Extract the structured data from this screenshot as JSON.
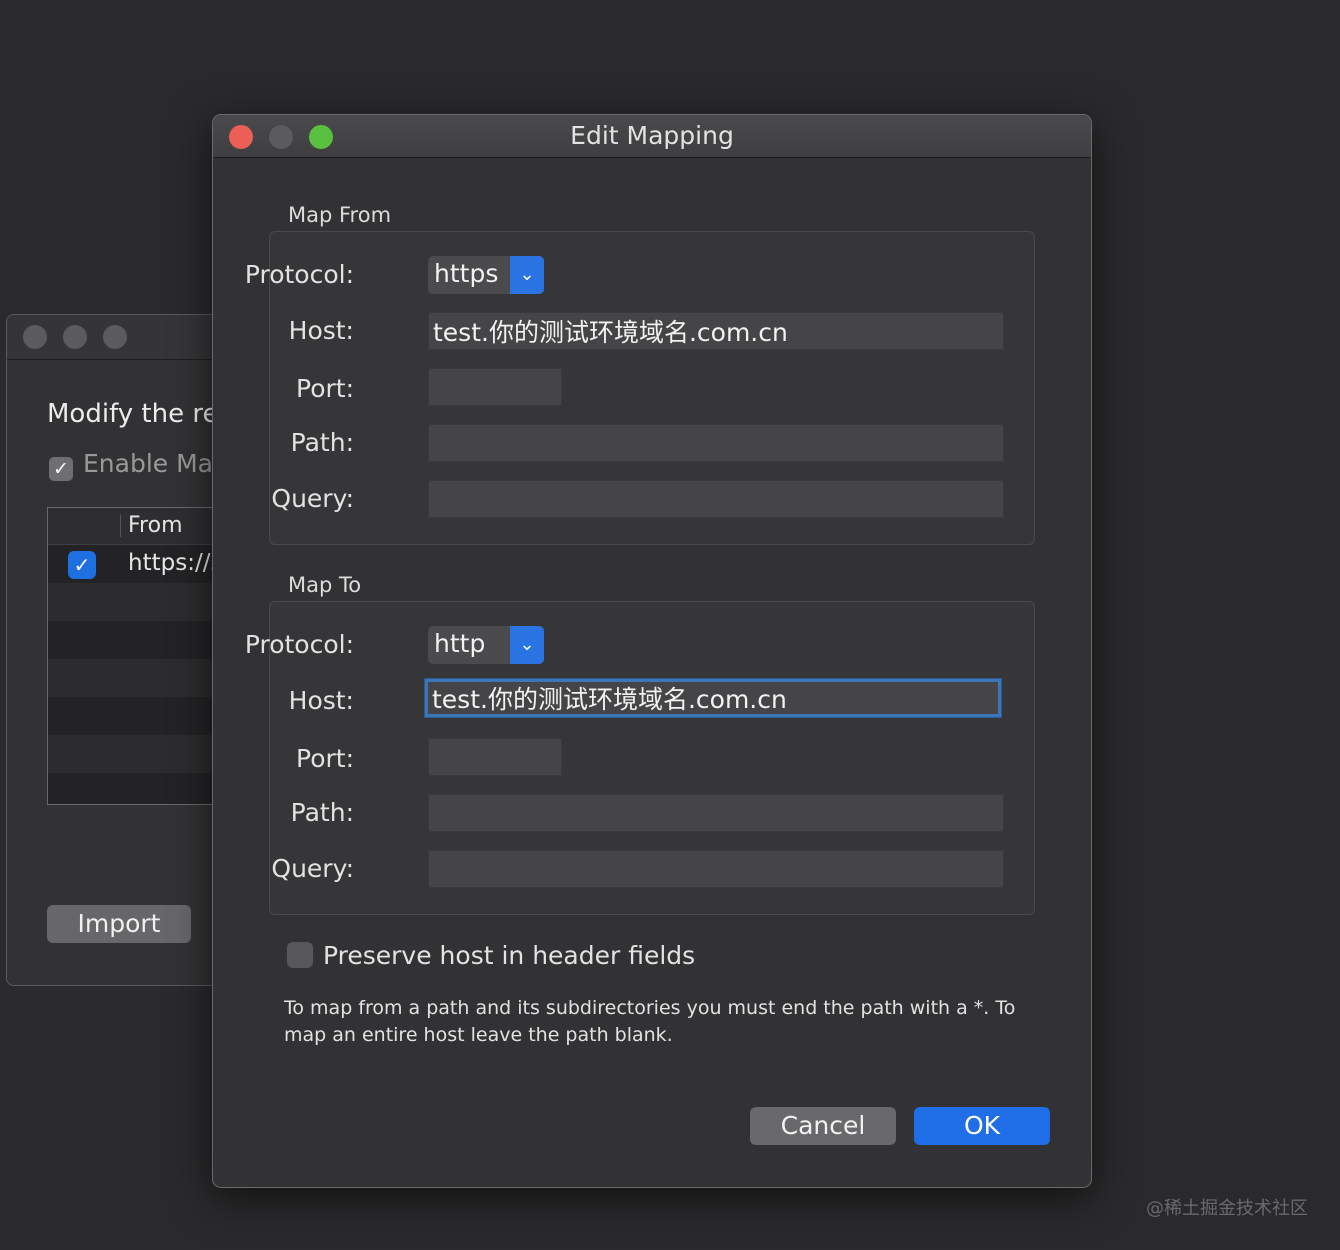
{
  "background_window": {
    "heading": "Modify the re",
    "enable_label": "Enable Ma",
    "column_header": "From",
    "rows": [
      {
        "checked": true,
        "url": "https://s"
      }
    ],
    "import_button": "Import"
  },
  "dialog": {
    "title": "Edit Mapping",
    "map_from": {
      "label": "Map From",
      "protocol_label": "Protocol:",
      "protocol_value": "https",
      "host_label": "Host:",
      "host_value": "test.你的测试环境域名.com.cn",
      "port_label": "Port:",
      "port_value": "",
      "path_label": "Path:",
      "path_value": "",
      "query_label": "Query:",
      "query_value": ""
    },
    "map_to": {
      "label": "Map To",
      "protocol_label": "Protocol:",
      "protocol_value": "http",
      "host_label": "Host:",
      "host_value": "test.你的测试环境域名.com.cn",
      "port_label": "Port:",
      "port_value": "",
      "path_label": "Path:",
      "path_value": "",
      "query_label": "Query:",
      "query_value": ""
    },
    "preserve_host_label": "Preserve host in header fields",
    "preserve_host_checked": false,
    "note": "To map from a path and its subdirectories you must end the path with a *. To map an entire host leave the path blank.",
    "cancel_button": "Cancel",
    "ok_button": "OK"
  },
  "watermark": "@稀土掘金技术社区",
  "colors": {
    "close": "#ec5f57",
    "minimize": "#5b5b5d",
    "zoom": "#59c040",
    "accent": "#1f6ee8"
  }
}
